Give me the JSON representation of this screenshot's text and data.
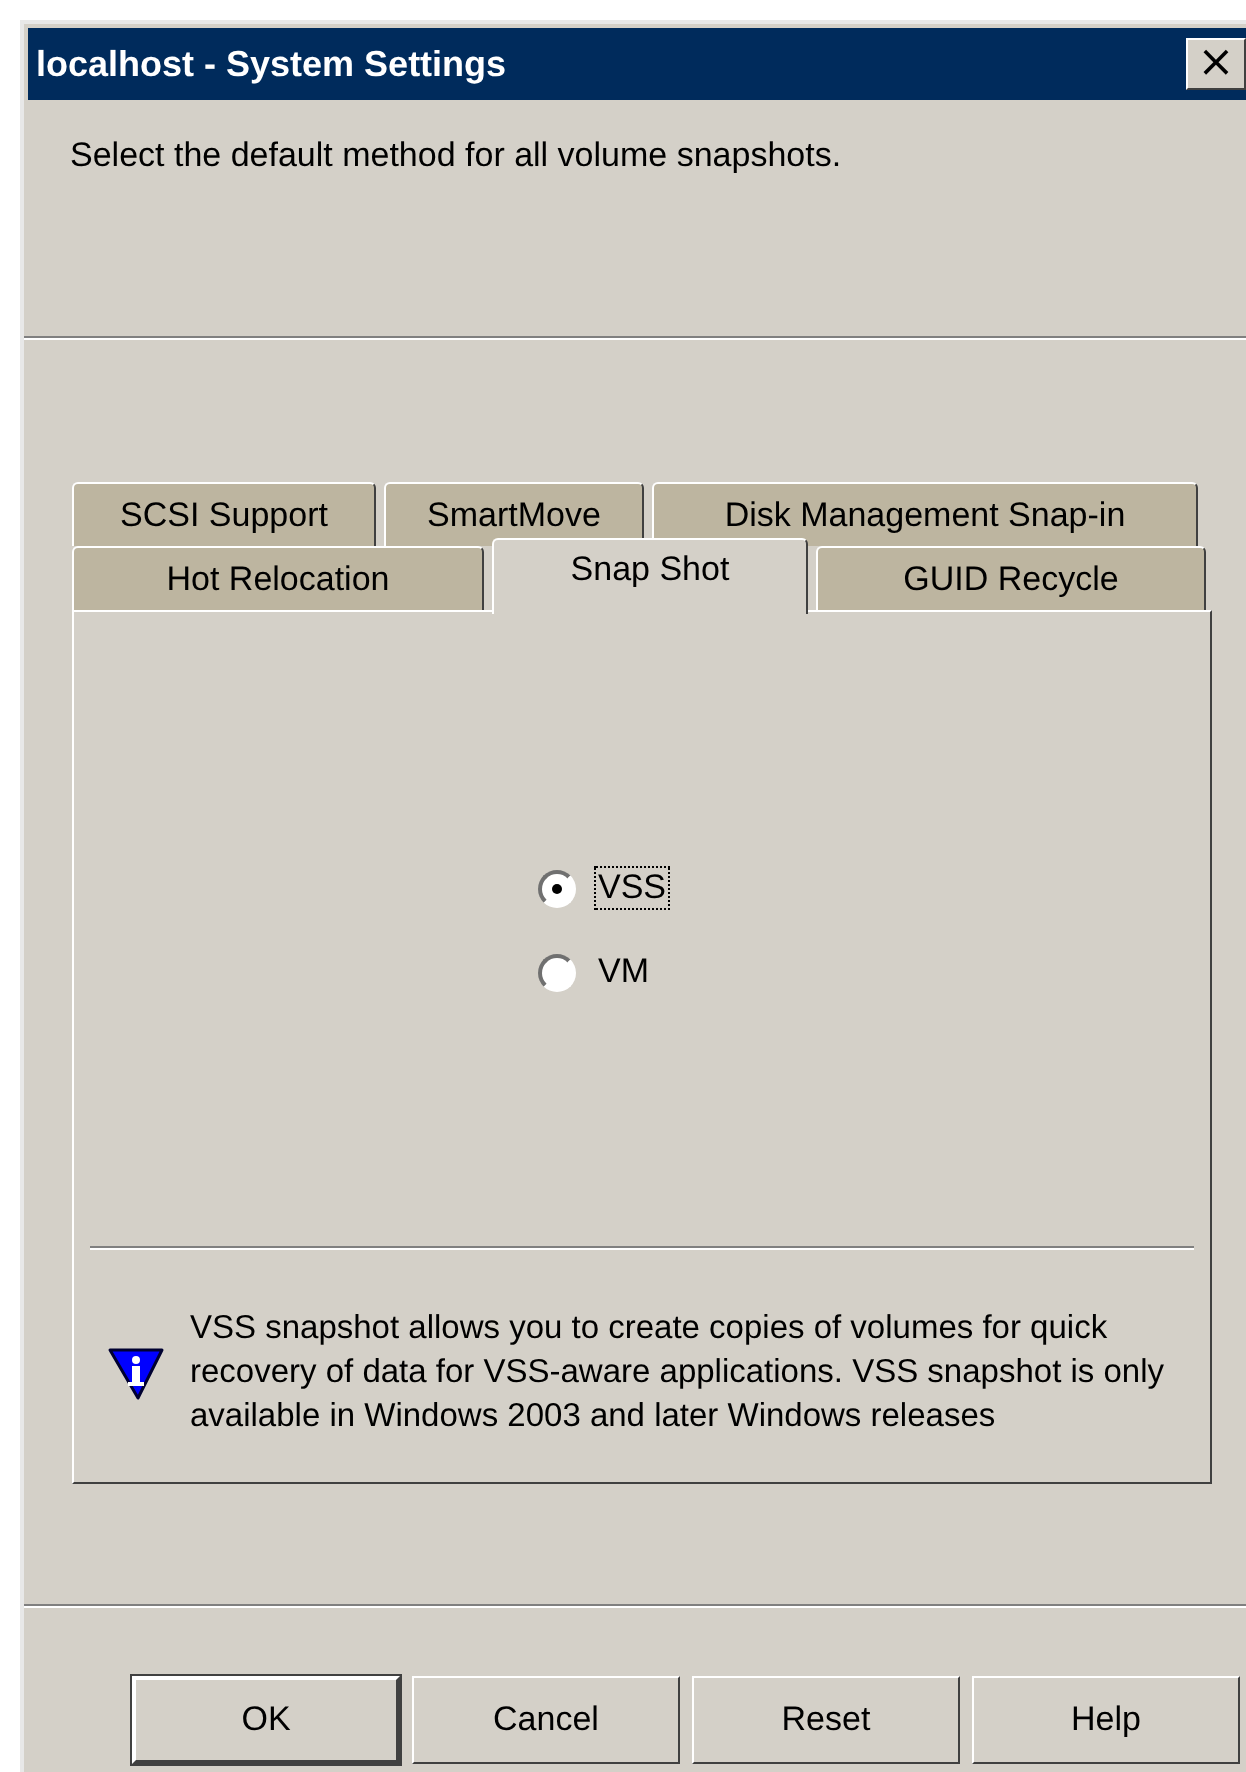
{
  "window": {
    "title": "localhost - System Settings",
    "close": "×"
  },
  "instruction": "Select the default method for all volume snapshots.",
  "tab_rows": [
    {
      "tabs": [
        {
          "label": "SCSI Support",
          "selected": false
        },
        {
          "label": "SmartMove",
          "selected": false
        },
        {
          "label": "Disk Management Snap-in",
          "selected": false
        }
      ]
    },
    {
      "tabs": [
        {
          "label": "Hot Relocation",
          "selected": false
        },
        {
          "label": "Snap Shot",
          "selected": true
        },
        {
          "label": "GUID Recycle",
          "selected": false
        }
      ]
    }
  ],
  "options": [
    {
      "label": "VSS",
      "selected": true,
      "focused": true
    },
    {
      "label": "VM",
      "selected": false,
      "focused": false
    }
  ],
  "info": "VSS snapshot allows you to create copies of volumes for quick recovery of data for VSS-aware applications. VSS snapshot is only available in Windows 2003 and later Windows releases",
  "buttons": [
    {
      "label": "OK",
      "default": true
    },
    {
      "label": "Cancel",
      "default": false
    },
    {
      "label": "Reset",
      "default": false
    },
    {
      "label": "Help",
      "default": false
    }
  ]
}
